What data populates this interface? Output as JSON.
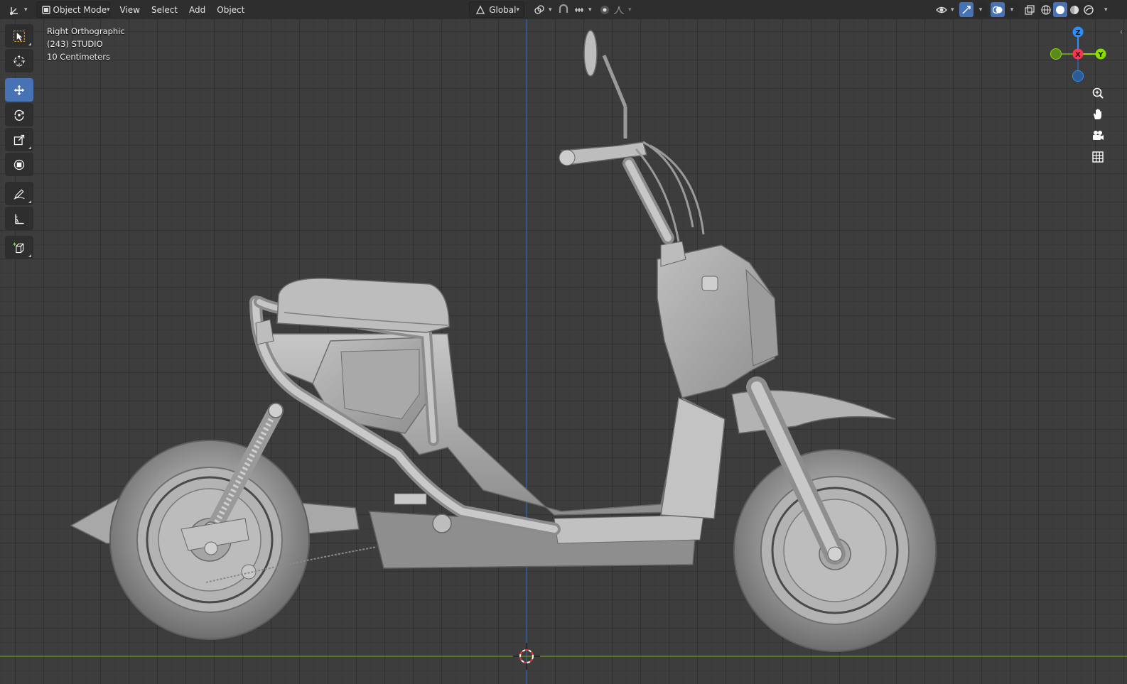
{
  "header": {
    "editor_type_icon": "axis-gizmo-icon",
    "mode": "Object Mode",
    "menus": [
      "View",
      "Select",
      "Add",
      "Object"
    ],
    "transform_orientation": "Global",
    "icons": [
      "transform-pivot-icon",
      "snap-icon",
      "snap-increment-icon",
      "proportional-edit-icon",
      "falloff-icon",
      "visibility-icon",
      "gizmo-icon",
      "overlay-icon",
      "xray-icon",
      "wireframe-shading-icon",
      "solid-shading-icon",
      "material-shading-icon",
      "rendered-shading-icon"
    ]
  },
  "viewport_info": {
    "view": "Right Orthographic",
    "collection": "(243) STUDIO",
    "scale": "10 Centimeters"
  },
  "toolbar": {
    "tools": [
      "select-box",
      "cursor",
      "move",
      "rotate",
      "scale",
      "transform",
      "annotate",
      "measure",
      "add-cube"
    ],
    "active": "move"
  },
  "gizmo": {
    "axes": [
      "Z",
      "X",
      "Y"
    ],
    "colors": {
      "x": "#ff3352",
      "y": "#8bdc00",
      "z": "#2890ff"
    }
  },
  "nav_buttons": [
    "zoom-icon",
    "pan-hand-icon",
    "camera-icon",
    "grid-ortho-icon"
  ]
}
